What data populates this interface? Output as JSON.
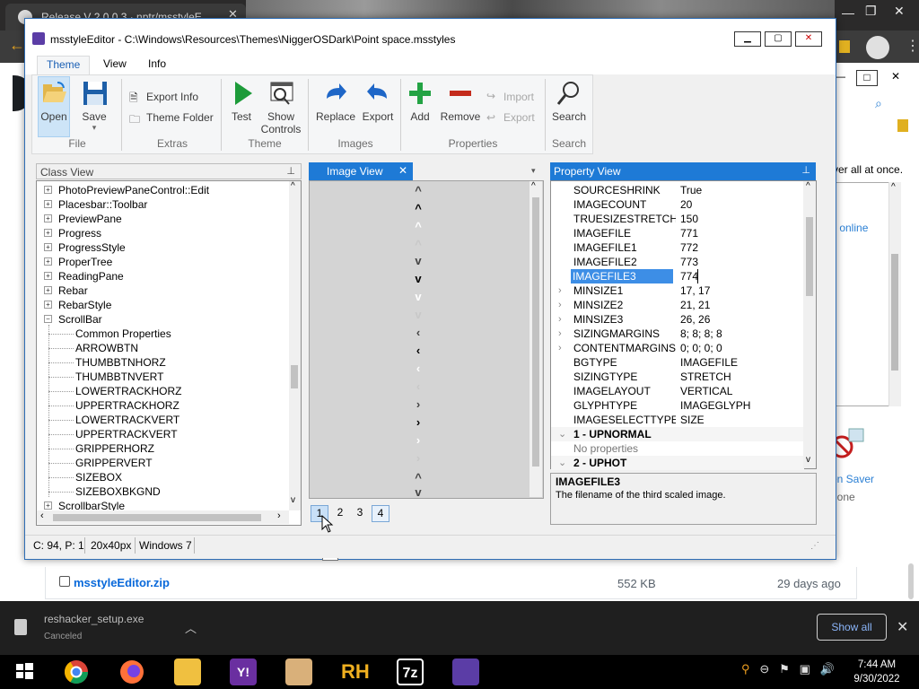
{
  "browser": {
    "tab_title": "Release V 2.0.0.3 · nptr/msstyleE",
    "download_file": "msstyleEditor.zip",
    "download_size": "552 KB",
    "download_age": "29 days ago",
    "side_text": "ver all at once.",
    "side_link": "s online",
    "side_screensaver": "en Saver",
    "side_none": "None"
  },
  "shelf": {
    "file": "reshacker_setup.exe",
    "state": "Canceled",
    "show_all": "Show all"
  },
  "taskbar": {
    "time": "7:44 AM",
    "date": "9/30/2022",
    "apps": [
      "RH",
      "7z"
    ]
  },
  "app": {
    "title": "msstyleEditor - C:\\Windows\\Resources\\Themes\\NiggerOSDark\\Point space.msstyles",
    "ribbon_tabs": [
      "Theme",
      "View",
      "Info"
    ],
    "groups": {
      "file": "File",
      "extras": "Extras",
      "theme": "Theme",
      "images": "Images",
      "properties": "Properties",
      "search": "Search"
    },
    "buttons": {
      "open": "Open",
      "save": "Save",
      "export_info": "Export Info",
      "theme_folder": "Theme Folder",
      "test": "Test",
      "show": "Show",
      "controls": "Controls",
      "replace": "Replace",
      "export": "Export",
      "add": "Add",
      "remove": "Remove",
      "import": "Import",
      "export2": "Export",
      "search": "Search"
    },
    "class_view": {
      "title": "Class View",
      "items": [
        {
          "label": "PhotoPreviewPaneControl::Edit",
          "level": 0,
          "expander": "+"
        },
        {
          "label": "Placesbar::Toolbar",
          "level": 0,
          "expander": "+"
        },
        {
          "label": "PreviewPane",
          "level": 0,
          "expander": "+"
        },
        {
          "label": "Progress",
          "level": 0,
          "expander": "+"
        },
        {
          "label": "ProgressStyle",
          "level": 0,
          "expander": "+"
        },
        {
          "label": "ProperTree",
          "level": 0,
          "expander": "+"
        },
        {
          "label": "ReadingPane",
          "level": 0,
          "expander": "+"
        },
        {
          "label": "Rebar",
          "level": 0,
          "expander": "+"
        },
        {
          "label": "RebarStyle",
          "level": 0,
          "expander": "+"
        },
        {
          "label": "ScrollBar",
          "level": 0,
          "expander": "−"
        },
        {
          "label": "Common Properties",
          "level": 1,
          "expander": ""
        },
        {
          "label": "ARROWBTN",
          "level": 1,
          "expander": ""
        },
        {
          "label": "THUMBBTNHORZ",
          "level": 1,
          "expander": ""
        },
        {
          "label": "THUMBBTNVERT",
          "level": 1,
          "expander": ""
        },
        {
          "label": "LOWERTRACKHORZ",
          "level": 1,
          "expander": ""
        },
        {
          "label": "UPPERTRACKHORZ",
          "level": 1,
          "expander": ""
        },
        {
          "label": "LOWERTRACKVERT",
          "level": 1,
          "expander": ""
        },
        {
          "label": "UPPERTRACKVERT",
          "level": 1,
          "expander": ""
        },
        {
          "label": "GRIPPERHORZ",
          "level": 1,
          "expander": ""
        },
        {
          "label": "GRIPPERVERT",
          "level": 1,
          "expander": ""
        },
        {
          "label": "SIZEBOX",
          "level": 1,
          "expander": ""
        },
        {
          "label": "SIZEBOXBKGND",
          "level": 1,
          "expander": ""
        },
        {
          "label": "ScrollbarStyle",
          "level": 0,
          "expander": "+"
        }
      ]
    },
    "image_view": {
      "title": "Image View",
      "close": "✕",
      "pages": [
        "1",
        "2",
        "3",
        "4"
      ],
      "tooltip": "1"
    },
    "property_view": {
      "title": "Property View",
      "rows": [
        {
          "key": "SOURCESHRINK",
          "value": "True",
          "arrow": ""
        },
        {
          "key": "IMAGECOUNT",
          "value": "20",
          "arrow": ""
        },
        {
          "key": "TRUESIZESTRETCHM",
          "value": "150",
          "arrow": ""
        },
        {
          "key": "IMAGEFILE",
          "value": "771",
          "arrow": ""
        },
        {
          "key": "IMAGEFILE1",
          "value": "772",
          "arrow": ""
        },
        {
          "key": "IMAGEFILE2",
          "value": "773",
          "arrow": ""
        },
        {
          "key": "IMAGEFILE3",
          "value": "774",
          "arrow": ""
        },
        {
          "key": "MINSIZE1",
          "value": "17, 17",
          "arrow": "›"
        },
        {
          "key": "MINSIZE2",
          "value": "21, 21",
          "arrow": "›"
        },
        {
          "key": "MINSIZE3",
          "value": "26, 26",
          "arrow": "›"
        },
        {
          "key": "SIZINGMARGINS",
          "value": "8; 8; 8; 8",
          "arrow": "›"
        },
        {
          "key": "CONTENTMARGINS",
          "value": "0; 0; 0; 0",
          "arrow": "›"
        },
        {
          "key": "BGTYPE",
          "value": "IMAGEFILE",
          "arrow": ""
        },
        {
          "key": "SIZINGTYPE",
          "value": "STRETCH",
          "arrow": ""
        },
        {
          "key": "IMAGELAYOUT",
          "value": "VERTICAL",
          "arrow": ""
        },
        {
          "key": "GLYPHTYPE",
          "value": "IMAGEGLYPH",
          "arrow": ""
        },
        {
          "key": "IMAGESELECTTYPE",
          "value": "SIZE",
          "arrow": ""
        }
      ],
      "section1": "1 - UPNORMAL",
      "no_props": "No properties",
      "section2": "2 - UPHOT",
      "desc_title": "IMAGEFILE3",
      "desc_text": "The filename of the third scaled image."
    },
    "status": {
      "pos": "C: 94, P: 1",
      "size": "20x40px",
      "os": "Windows 7"
    },
    "colors": {
      "accent": "#1e7ad6",
      "selection": "#3d8ee6"
    }
  }
}
